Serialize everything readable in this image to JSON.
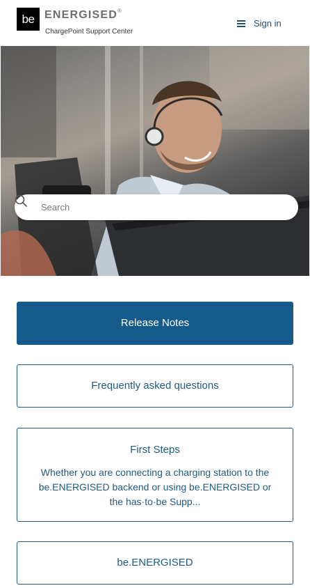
{
  "header": {
    "logo_mark": "be",
    "brand_name": "ENERGISED",
    "brand_symbol": "®",
    "tagline": "ChargePoint Support Center",
    "menu_icon": "hamburger-menu-icon",
    "signin_label": "Sign in"
  },
  "search": {
    "placeholder": "Search",
    "icon": "search-icon"
  },
  "categories": [
    {
      "title": "Release Notes"
    },
    {
      "title": "Frequently asked questions"
    },
    {
      "title": "First Steps",
      "description": "Whether you are connecting a charging station to the be.ENERGISED backend or using be.ENERGISED or the has·to·be Supp..."
    },
    {
      "title": "be.ENERGISED"
    }
  ],
  "colors": {
    "accent": "#1f5a82",
    "primary_fill": "#145a8a",
    "text_muted": "#6e6e6e"
  }
}
